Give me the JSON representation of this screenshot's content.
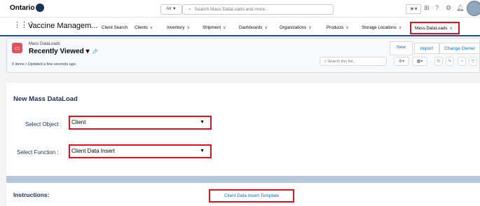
{
  "global": {
    "logo_text": "Ontario",
    "search_scope": "All ▼",
    "search_placeholder": "Search Mass DataLoads and more..."
  },
  "nav": {
    "app_name": "Vaccine Managem...",
    "items": [
      {
        "label": "Client Search"
      },
      {
        "label": "Clients"
      },
      {
        "label": "Inventory"
      },
      {
        "label": "Shipment"
      },
      {
        "label": "Dashboards"
      },
      {
        "label": "Organizations"
      },
      {
        "label": "Products"
      },
      {
        "label": "Storage Locations"
      },
      {
        "label": "Mass DataLoads"
      }
    ]
  },
  "list_header": {
    "object_label": "Mass DataLoads",
    "view_name": "Recently Viewed",
    "meta": "0 items • Updated a few seconds ago",
    "new_button": "New",
    "import_button": "Import",
    "change_owner_button": "Change Owner",
    "search_placeholder": "Search this list..."
  },
  "form": {
    "title": "New Mass DataLoad",
    "select_object_label": "Select Object :",
    "select_object_value": "Client",
    "select_function_label": "Select Function :",
    "select_function_value": "Client Data Insert",
    "instructions_label": "Instructions:",
    "template_link": "Client Data Insert Template"
  },
  "colors": {
    "highlight_red": "#e2131a",
    "link_blue": "#0070d2",
    "nav_accent": "#1b5297"
  }
}
